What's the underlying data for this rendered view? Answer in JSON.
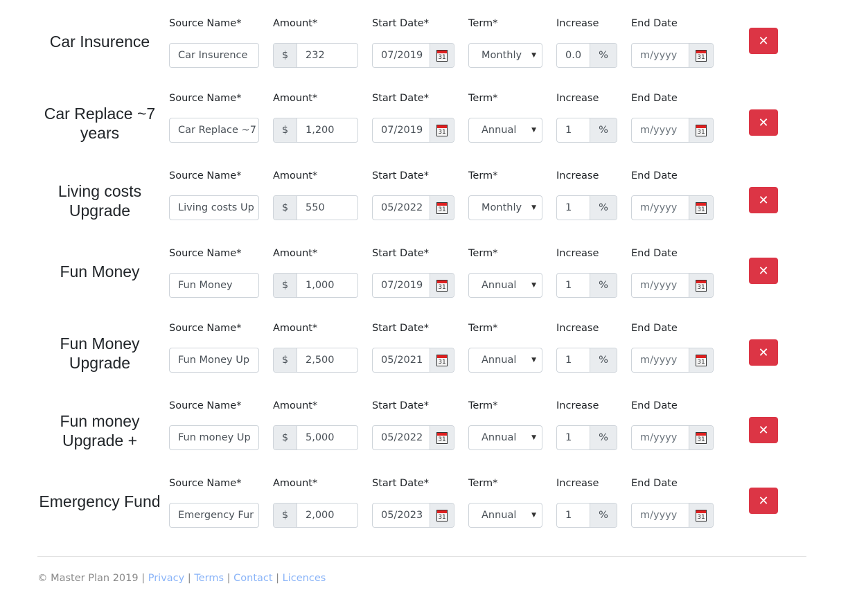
{
  "labels": {
    "source_name": "Source Name*",
    "amount": "Amount*",
    "start_date": "Start Date*",
    "term": "Term*",
    "increase": "Increase",
    "end_date": "End Date",
    "currency_symbol": "$",
    "percent_symbol": "%",
    "end_date_placeholder": "m/yyyy",
    "calendar_day": "31",
    "delete_glyph": "✕"
  },
  "rows": [
    {
      "title": "Car Insurence",
      "source_name": "Car Insurence",
      "amount": "232",
      "start_date": "07/2019",
      "term": "Monthly",
      "increase": "0.0",
      "end_date": ""
    },
    {
      "title": "Car Replace ~7 years",
      "source_name": "Car Replace ~7",
      "amount": "1,200",
      "start_date": "07/2019",
      "term": "Annual",
      "increase": "1",
      "end_date": ""
    },
    {
      "title": "Living costs Upgrade",
      "source_name": "Living costs Up",
      "amount": "550",
      "start_date": "05/2022",
      "term": "Monthly",
      "increase": "1",
      "end_date": ""
    },
    {
      "title": "Fun Money",
      "source_name": "Fun Money",
      "amount": "1,000",
      "start_date": "07/2019",
      "term": "Annual",
      "increase": "1",
      "end_date": ""
    },
    {
      "title": "Fun Money Upgrade",
      "source_name": "Fun Money Up",
      "amount": "2,500",
      "start_date": "05/2021",
      "term": "Annual",
      "increase": "1",
      "end_date": ""
    },
    {
      "title": "Fun money Upgrade +",
      "source_name": "Fun money Up",
      "amount": "5,000",
      "start_date": "05/2022",
      "term": "Annual",
      "increase": "1",
      "end_date": ""
    },
    {
      "title": "Emergency Fund",
      "source_name": "Emergency Fur",
      "amount": "2,000",
      "start_date": "05/2023",
      "term": "Annual",
      "increase": "1",
      "end_date": ""
    }
  ],
  "footer": {
    "copyright": "© Master Plan 2019",
    "separator": "|",
    "links": [
      "Privacy",
      "Terms",
      "Contact",
      "Licences"
    ]
  },
  "colors": {
    "danger": "#dc3545",
    "link": "#8ab4f8",
    "addon_bg": "#e9ecef"
  }
}
